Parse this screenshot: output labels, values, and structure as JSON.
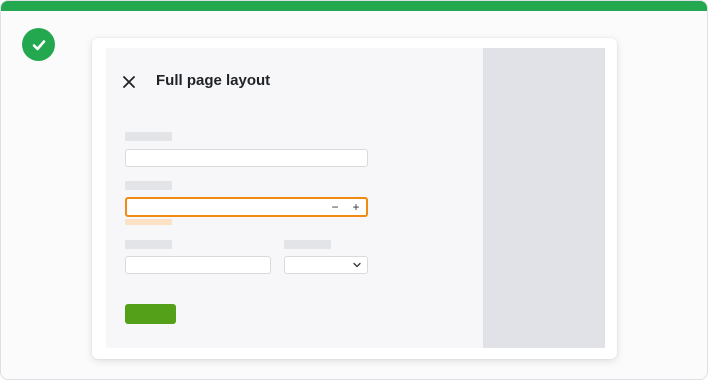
{
  "status": {
    "icon": "check-circle-icon",
    "color": "#23a74f"
  },
  "modal": {
    "close_icon": "close-icon",
    "title": "Full page layout"
  },
  "form": {
    "quantity_stepper": {
      "decrement": "−",
      "increment": "+"
    },
    "select_icon": "chevron-down-icon",
    "submit_color": "#54a119",
    "focus_color": "#f08a10"
  }
}
